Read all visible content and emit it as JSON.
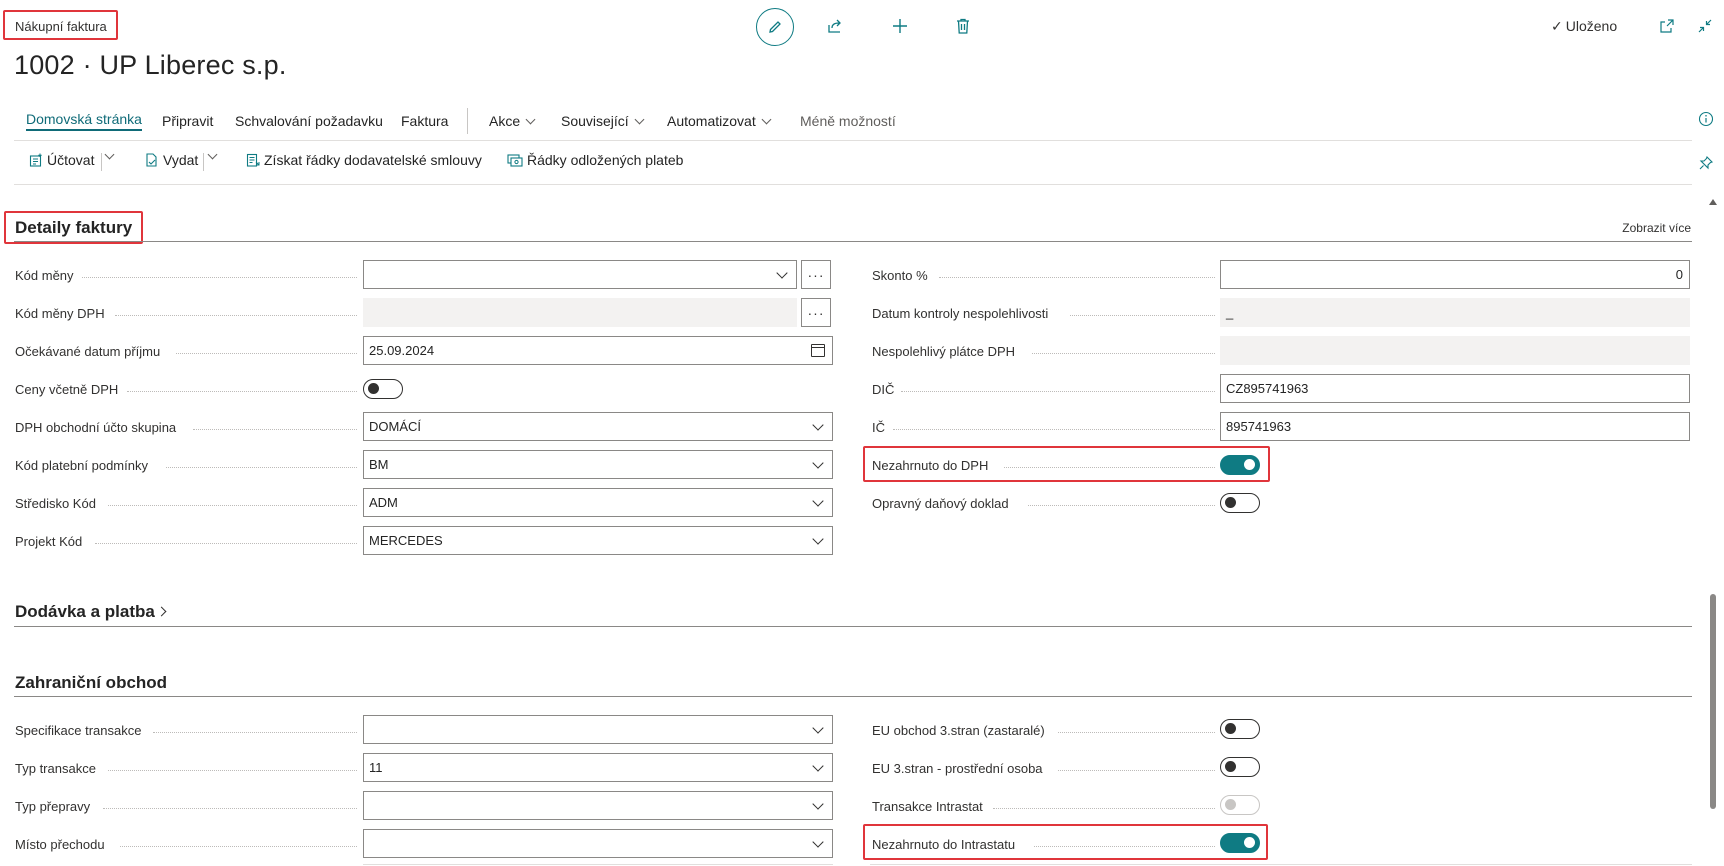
{
  "page": {
    "caption": "Nákupní faktura",
    "title": "1002 · UP Liberec s.p.",
    "saved_label": "Uloženo"
  },
  "icons": {
    "edit": "pencil-icon",
    "share": "share-icon",
    "new": "plus-icon",
    "delete": "trash-icon",
    "popout": "popout-icon",
    "collapse": "collapse-icon",
    "info": "info-icon",
    "pin": "pin-icon"
  },
  "nav": {
    "home": "Domovská stránka",
    "prepare": "Připravit",
    "approval": "Schvalování požadavku",
    "invoice": "Faktura",
    "actions": "Akce",
    "related": "Související",
    "automate": "Automatizovat",
    "fewer": "Méně možností"
  },
  "actions": {
    "post": "Účtovat",
    "release": "Vydat",
    "get_lines": "Získat řádky dodavatelské smlouvy",
    "deferred": "Řádky odložených plateb"
  },
  "invoice_details": {
    "title": "Detaily faktury",
    "show_more": "Zobrazit více",
    "currency_code": {
      "label": "Kód měny",
      "value": ""
    },
    "vat_currency_code": {
      "label": "Kód měny DPH",
      "value": ""
    },
    "expected_receipt_date": {
      "label": "Očekávané datum příjmu",
      "value": "25.09.2024"
    },
    "prices_incl_vat": {
      "label": "Ceny včetně DPH",
      "on": false
    },
    "vat_bus_posting_group": {
      "label": "DPH obchodní účto skupina",
      "value": "DOMÁCÍ"
    },
    "payment_terms_code": {
      "label": "Kód platební podmínky",
      "value": "BM"
    },
    "dept_code": {
      "label": "Středisko Kód",
      "value": "ADM"
    },
    "project_code": {
      "label": "Projekt Kód",
      "value": "MERCEDES"
    },
    "discount_pct": {
      "label": "Skonto %",
      "value": "0"
    },
    "unreliability_check_date": {
      "label": "Datum kontroly nespolehlivosti",
      "value": "_"
    },
    "unreliable_payer": {
      "label": "Nespolehlivý plátce DPH",
      "value": ""
    },
    "vat_reg_no": {
      "label": "DIČ",
      "value": "CZ895741963"
    },
    "reg_no": {
      "label": "IČ",
      "value": "895741963"
    },
    "not_in_vat": {
      "label": "Nezahrnuto do DPH",
      "on": true
    },
    "corrective_doc": {
      "label": "Opravný daňový doklad",
      "on": false
    }
  },
  "delivery": {
    "title": "Dodávka a platba"
  },
  "foreign_trade": {
    "title": "Zahraniční obchod",
    "transaction_spec": {
      "label": "Specifikace transakce",
      "value": ""
    },
    "transaction_type": {
      "label": "Typ transakce",
      "value": "11"
    },
    "transport_method": {
      "label": "Typ přepravy",
      "value": ""
    },
    "entry_exit_point": {
      "label": "Místo přechodu",
      "value": ""
    },
    "eu_3party_obsolete": {
      "label": "EU obchod 3.stran (zastaralé)",
      "on": false
    },
    "eu_3party_intermediate": {
      "label": "EU 3.stran - prostřední osoba",
      "on": false
    },
    "intrastat_transaction": {
      "label": "Transakce Intrastat",
      "on": false
    },
    "not_in_intrastat": {
      "label": "Nezahrnuto do Intrastatu",
      "on": true
    }
  },
  "colors": {
    "accent": "#0f7b83",
    "highlight": "#e0353b"
  }
}
